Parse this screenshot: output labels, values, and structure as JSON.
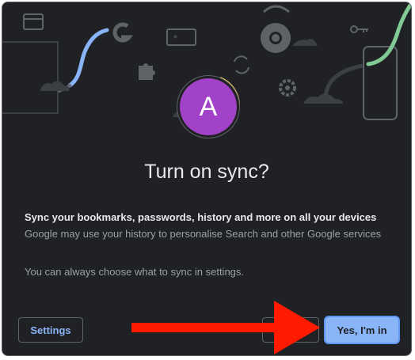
{
  "dialog": {
    "avatar_initial": "A",
    "title": "Turn on sync?",
    "sync_description": "Sync your bookmarks, passwords, history and more on all your devices",
    "personalise_note": "Google may use your history to personalise Search and other Google services",
    "settings_note": "You can always choose what to sync in settings."
  },
  "buttons": {
    "settings": "Settings",
    "cancel": "",
    "confirm": "Yes, I'm in"
  },
  "colors": {
    "background": "#202124",
    "avatar": "#a142c9",
    "accent": "#8ab4f8",
    "annotation_arrow": "#ff1a00"
  }
}
